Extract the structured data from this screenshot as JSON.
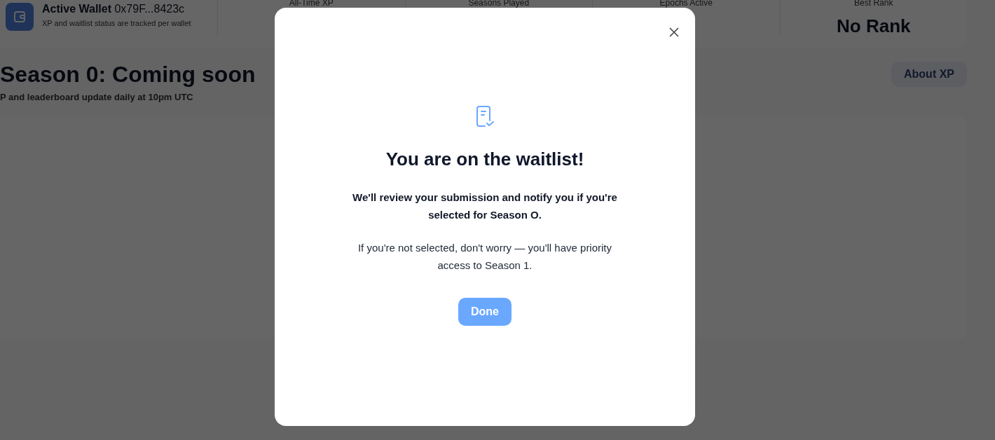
{
  "wallet": {
    "label": "Active Wallet",
    "address": "0x79F...8423c",
    "note": "XP and waitlist status are tracked per wallet"
  },
  "stats": [
    {
      "label": "All-Time XP"
    },
    {
      "label": "Seasons Played"
    },
    {
      "label": "Epochs Active"
    },
    {
      "label": "Best Rank",
      "value": "No Rank"
    }
  ],
  "season": {
    "title": "Season 0: Coming soon",
    "subtitle": "P and leaderboard update daily at 10pm UTC",
    "button": "About XP"
  },
  "modal": {
    "title": "You are on the waitlist!",
    "lead": "We'll review your submission and notify you if you're selected for Season O.",
    "body": "If you're not selected, don't worry — you'll have priority access to Season 1.",
    "button": "Done"
  }
}
